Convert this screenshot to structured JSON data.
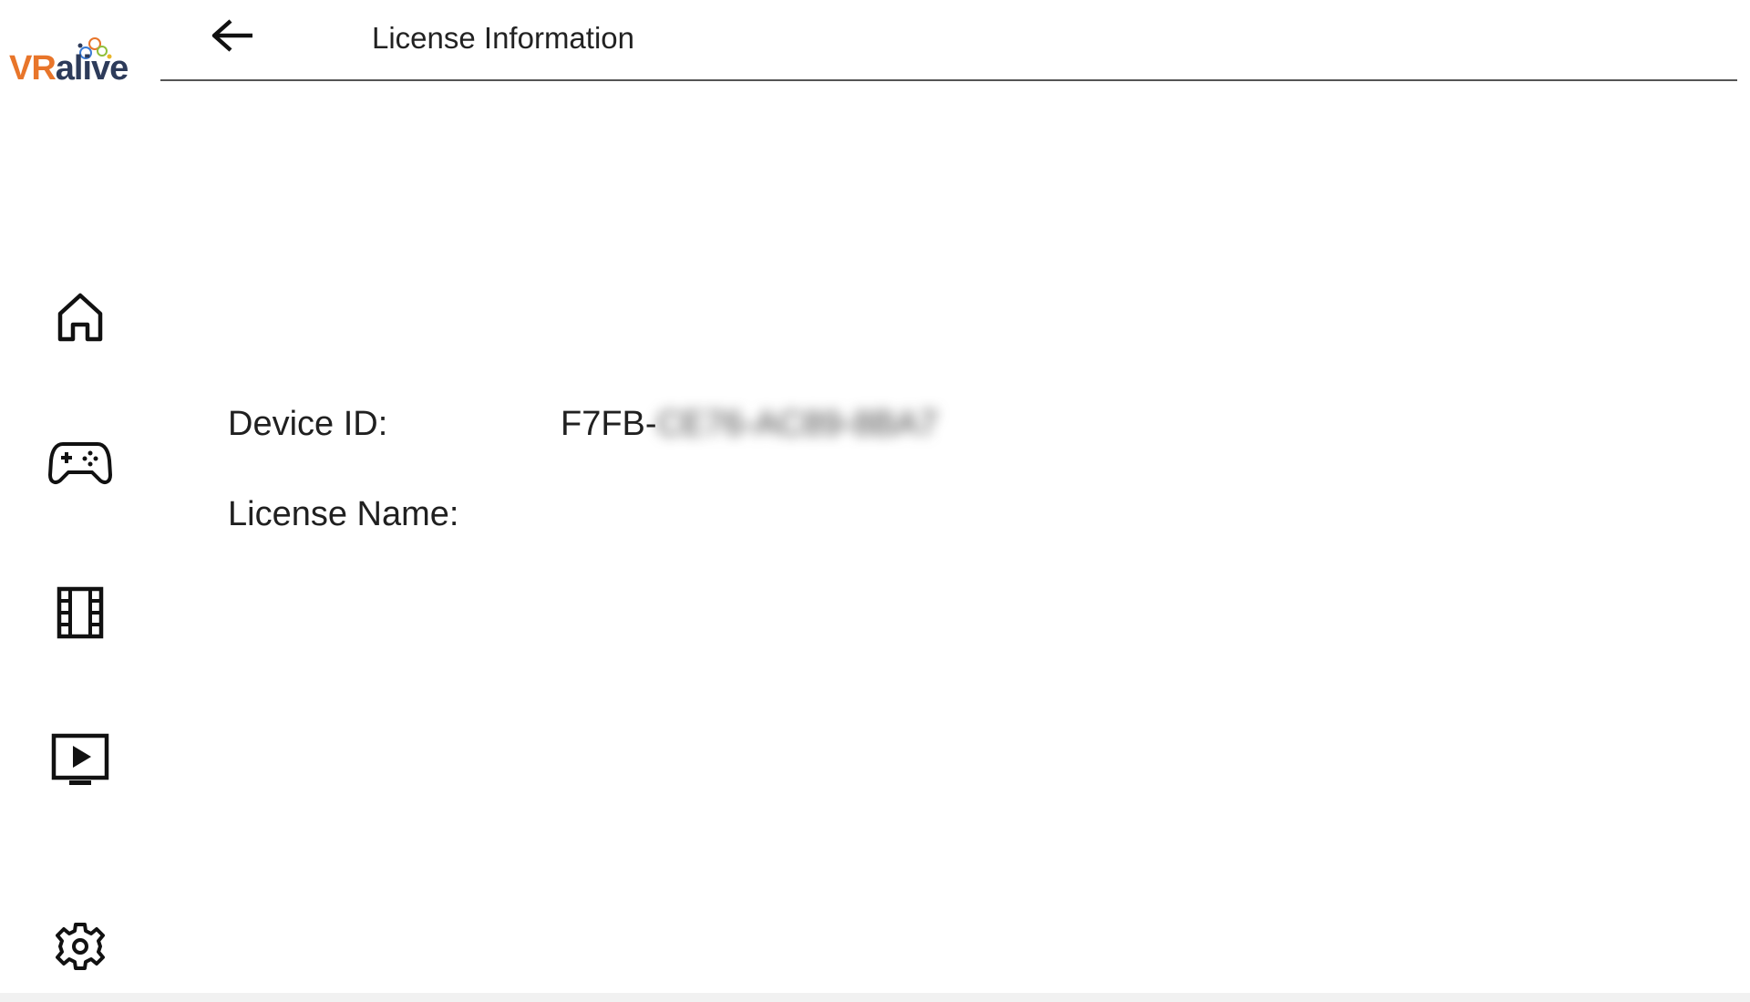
{
  "brand": {
    "logo_vr": "VR",
    "logo_alive": "alive",
    "vr_color": "#e8752a",
    "alive_color": "#2d3b5a"
  },
  "header": {
    "title": "License Information",
    "back_icon": "arrow-left-icon"
  },
  "sidebar": {
    "items": [
      {
        "name": "home",
        "icon": "home-icon"
      },
      {
        "name": "games",
        "icon": "gamepad-icon"
      },
      {
        "name": "videos",
        "icon": "film-icon"
      },
      {
        "name": "player",
        "icon": "play-screen-icon"
      },
      {
        "name": "settings",
        "icon": "gear-icon"
      }
    ]
  },
  "license": {
    "device_id_label": "Device ID:",
    "device_id_value_visible": "F7FB-",
    "device_id_value_blurred": "CE76-AC89-8BA7",
    "license_name_label": "License Name:",
    "license_name_value": ""
  }
}
